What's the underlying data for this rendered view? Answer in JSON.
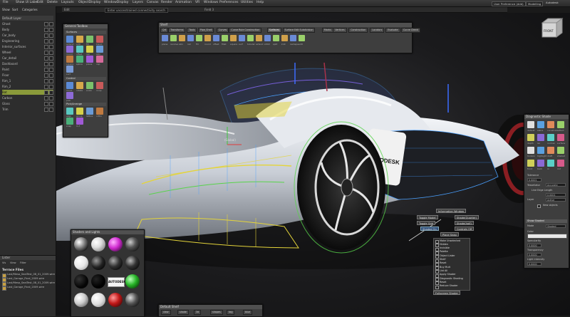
{
  "menubar": {
    "items": [
      "File",
      "Show Ui Label",
      "Edit",
      "Delete",
      "Layouts",
      "ObjectDisplay",
      "WindowDisplay",
      "Layers",
      "Canvas",
      "Render",
      "Animation",
      "VR",
      "Windows",
      "Preferences",
      "Utilities",
      "Help"
    ],
    "workspace_label": "User Preference (ddd)",
    "workspace_value": "Modelling",
    "user": "Autodesk"
  },
  "titlebar": {
    "text1": "Edit",
    "text2": "Enter unconstrained connectivity search",
    "text3": "Field 3"
  },
  "left_panel": {
    "tabs": [
      "Show",
      "Sort",
      "Categories"
    ],
    "header": "Default Layer",
    "rows": [
      "Ghost",
      "Body",
      "Car_body",
      "Engineering",
      "Interior_surfaces",
      "Wheel",
      "Car_detail",
      "Dashboard",
      "Paint",
      "Floor",
      "Rim_1",
      "Rim_2",
      "Bat",
      "Carbon",
      "Glass",
      "Trim"
    ],
    "selected_row": "Bat"
  },
  "lister": {
    "title": "Lister",
    "menu": [
      "Vis",
      "View",
      "Filter"
    ],
    "header": "Terrace Files",
    "files": [
      "Last/Mesa_SealTest_08_01_2009.wire",
      "Last_Garage_Final_2009.wire",
      "Last/Mesa_SealTest_08_01_2009.wire",
      "Last_Garage_Final_2009.wire"
    ]
  },
  "palette": {
    "title": "General Toolbox",
    "section1": "Surfaces",
    "section2": "Control",
    "section3": "Pick/Arrange",
    "tools1": [
      "extend",
      "edit",
      "fill",
      "blend",
      "round",
      "offset",
      "rail",
      "skin",
      "square",
      "spline",
      "plane",
      "cap",
      "surf"
    ],
    "tools2": [
      "move",
      "rotate",
      "scale",
      "nonp",
      "pick"
    ],
    "tools3": [
      "align",
      "group",
      "lattice",
      "ortho",
      "snap",
      "ln-f"
    ]
  },
  "shelf": {
    "title": "Shelf",
    "tabs": [
      "Qrt",
      "Transforms",
      "Tools",
      "Pipe_Shell",
      "Curves",
      "Curve Rule Construction",
      "Surfaces",
      "Surface Edit Subdivision",
      "Marks",
      "Vertices",
      "Construction",
      "Locators",
      "Evaluate",
      "Curve Check"
    ],
    "active_tab": "Surfaces",
    "icon_labels": [
      "plane",
      "revolve",
      "skin",
      "rail",
      "fill",
      "round",
      "offset",
      "fillet",
      "square",
      "surf",
      "tubular",
      "extend",
      "stitch",
      "split",
      "knit",
      "reshape",
      "edit"
    ]
  },
  "diagnostic": {
    "title": "Diagnostic Shade",
    "tolerance_label": "Tolerance",
    "tolerance_value": "0.0001",
    "tessellate_label": "Tessellator",
    "tessellate_value": "Accurate",
    "edge_label": "Line Edge Length",
    "edge_value": "0.0001",
    "layer_label": "Layer",
    "layer_value": "Active",
    "new_objects_label": "New objects",
    "show_shaded_header": "Show Shaded",
    "mode_label": "Mode",
    "mode_value": "Shaded",
    "color_label": "Color",
    "specularity_label": "Specularity",
    "specularity_value": "0.0000",
    "transparency_label": "Transparency",
    "transparency_value": "0.0000",
    "light_label": "Light intensity",
    "light_value": "0.0000",
    "icon_labels": [
      "default",
      "zebra",
      "curvature",
      "reflect",
      "depth",
      "iso",
      "normal",
      "surface",
      "horizon",
      "highlight",
      "draft",
      "shaded",
      "front",
      "back",
      "rn",
      "rn2"
    ]
  },
  "shader_panel": {
    "title": "Shaders and Lights",
    "autodesk_label": "AUTODESK"
  },
  "bottom_bar": {
    "title": "Default Shelf",
    "items": [
      "view",
      "shade",
      "3d",
      "shapes",
      "tag",
      "blue"
    ]
  },
  "popup": {
    "info_window": "Information Window",
    "toggle_model": "Toggle Model",
    "shade_quarter": "Shade(Quarter)",
    "toggle_grid": "Toggle Grid",
    "shade_half": "Shade(half)",
    "shaded_on": "Shaded On",
    "controls_off": "Controls Off",
    "place_snap": "Place Snap",
    "items": [
      "Make Unselected",
      "Hidden",
      "Invisible",
      "Palette",
      "Object Lister",
      "Shelf",
      "Reset",
      "Buy Mult",
      "List All",
      "Apply Shader",
      "Diagnostic Shading",
      "Reset",
      "Reduce Shader"
    ],
    "bottom": "Fullscreen Shader"
  },
  "viewport": {
    "cube_label": "FRONT",
    "car_brand": "AUTODESK",
    "origin_label": "(Global)",
    "z_label": "z"
  },
  "colors": {
    "car_body": "#d7dbe3",
    "wheel_dark": "#151515",
    "rim_red": "#8a1e22",
    "wire_blue": "#4aa0ff",
    "wire_green": "#58d34a",
    "wire_yellow": "#e4d43a",
    "selection": "#8a9a3a"
  }
}
